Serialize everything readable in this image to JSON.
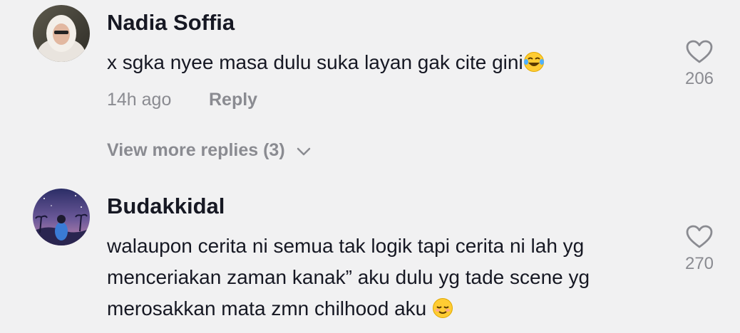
{
  "comments": [
    {
      "username": "Nadia Soffia",
      "text": "x sgka nyee masa dulu suka layan gak cite gini",
      "text_emoji": "face-with-tears-of-joy",
      "time": "14h ago",
      "reply_label": "Reply",
      "view_replies_label": "View more replies (3)",
      "likes": "206",
      "avatar_icon": "profile-photo"
    },
    {
      "username": "Budakkidal",
      "lines": [
        "walaupon cerita ni semua tak logik tapi cerita ni lah yg",
        "menceriakan zaman kanak” aku dulu yg tade scene yg",
        "merosakkan mata zmn chilhood aku"
      ],
      "text_emoji": "relieved-face",
      "likes": "270",
      "avatar_icon": "profile-illustration"
    }
  ],
  "colors": {
    "background": "#f1f1f2",
    "primary_text": "#161823",
    "secondary_text": "#8a8b91"
  }
}
